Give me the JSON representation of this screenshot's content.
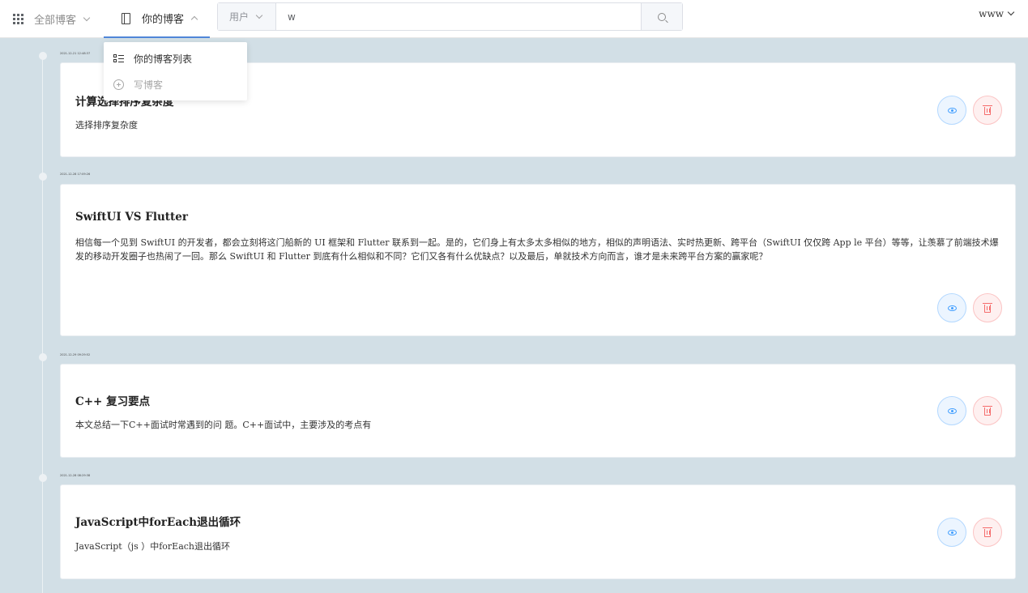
{
  "header": {
    "nav_all_label": "全部博客",
    "nav_mine_label": "你的博客",
    "search_scope_label": "用户",
    "search_value": "w",
    "user_name": "www"
  },
  "dropdown": {
    "items": [
      {
        "label": "你的博客列表",
        "icon": "list-icon",
        "disabled": false
      },
      {
        "label": "写博客",
        "icon": "plus-circle-icon",
        "disabled": true
      }
    ]
  },
  "posts": [
    {
      "date": "2021-12-21 12:48:37",
      "title": "计算选择排序复杂度",
      "desc": "选择排序复杂度"
    },
    {
      "date": "2021-12-28 17:09:26",
      "title": "SwiftUI VS Flutter",
      "desc": "相信每一个见到 SwiftUI 的开发者，都会立刻将这门船新的 UI 框架和 Flutter 联系到一起。是的，它们身上有太多太多相似的地方，相似的声明语法、实时热更新、跨平台（SwiftUI 仅仅跨 App le 平台）等等，让羡慕了前端技术爆发的移动开发圈子也热闹了一回。那么 SwiftUI 和 Flutter 到底有什么相似和不同？它们又各有什么优缺点？以及最后，单就技术方向而言，谁才是未来跨平台方案的赢家呢？"
    },
    {
      "date": "2021-12-29 09:29:52",
      "title": "C++ 复习要点",
      "desc": "本文总结一下C++面试时常遇到的问 题。C++面试中，主要涉及的考点有"
    },
    {
      "date": "2021-12-28 08:29:38",
      "title": "JavaScript中forEach退出循环",
      "desc": "JavaScript（js ）中forEach退出循环"
    }
  ]
}
